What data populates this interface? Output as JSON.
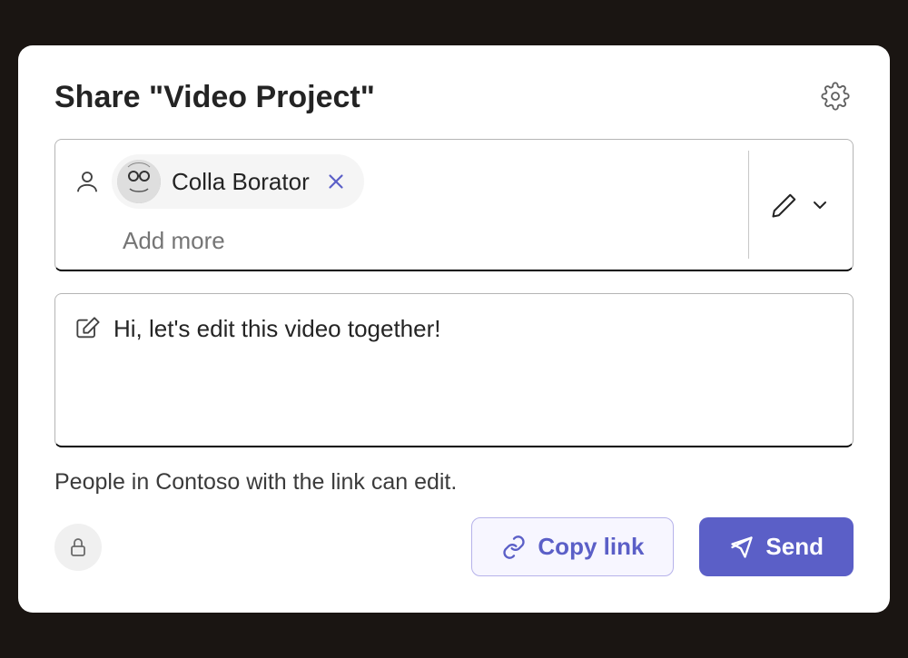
{
  "dialog": {
    "title": "Share \"Video Project\""
  },
  "recipients": {
    "chip": {
      "name": "Colla Borator"
    },
    "add_more_placeholder": "Add more"
  },
  "message": {
    "value": "Hi, let's edit this video together!"
  },
  "info": {
    "text": "People in Contoso with the link can edit."
  },
  "actions": {
    "copy_link": "Copy link",
    "send": "Send"
  }
}
